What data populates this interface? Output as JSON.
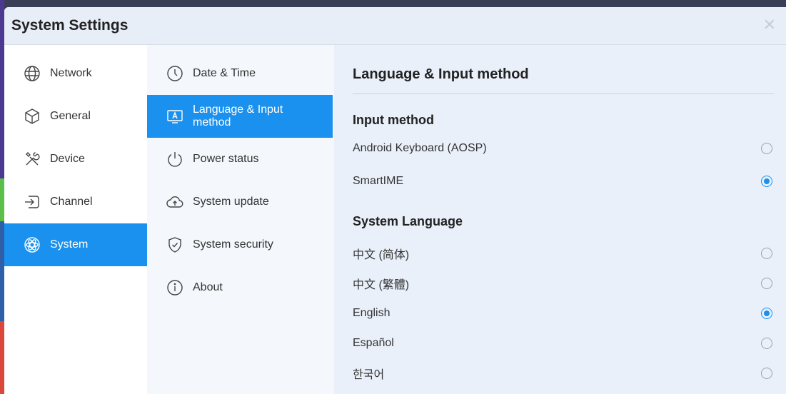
{
  "window": {
    "title": "System Settings",
    "close_glyph": "✕"
  },
  "categories": [
    {
      "label": "Network",
      "icon": "globe-icon",
      "active": false
    },
    {
      "label": "General",
      "icon": "cube-icon",
      "active": false
    },
    {
      "label": "Device",
      "icon": "tools-icon",
      "active": false
    },
    {
      "label": "Channel",
      "icon": "input-source-icon",
      "active": false
    },
    {
      "label": "System",
      "icon": "atom-icon",
      "active": true
    }
  ],
  "submenu": [
    {
      "label": "Date & Time",
      "icon": "clock-icon",
      "active": false
    },
    {
      "label": "Language & Input method",
      "icon": "keyboard-a-icon",
      "active": true
    },
    {
      "label": "Power status",
      "icon": "power-icon",
      "active": false
    },
    {
      "label": "System update",
      "icon": "cloud-upload-icon",
      "active": false
    },
    {
      "label": "System security",
      "icon": "shield-check-icon",
      "active": false
    },
    {
      "label": "About",
      "icon": "info-icon",
      "active": false
    }
  ],
  "panel": {
    "title": "Language & Input method",
    "input_method": {
      "heading": "Input method",
      "options": [
        {
          "label": "Android Keyboard (AOSP)",
          "selected": false
        },
        {
          "label": "SmartIME",
          "selected": true
        }
      ]
    },
    "system_language": {
      "heading": "System Language",
      "options": [
        {
          "label": "中文 (简体)",
          "selected": false
        },
        {
          "label": "中文 (繁體)",
          "selected": false
        },
        {
          "label": "English",
          "selected": true
        },
        {
          "label": "Español",
          "selected": false
        },
        {
          "label": "한국어",
          "selected": false
        }
      ]
    }
  },
  "colors": {
    "accent": "#1a91ee",
    "panel_bg": "#eaf0fa"
  }
}
